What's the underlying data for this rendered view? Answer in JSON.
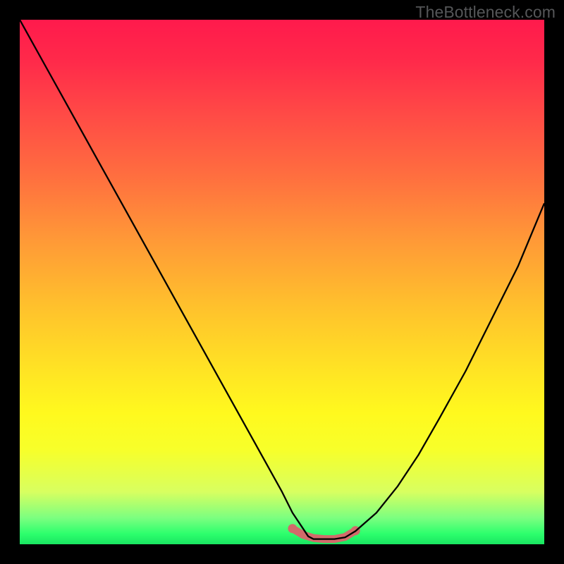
{
  "watermark": "TheBottleneck.com",
  "chart_data": {
    "type": "line",
    "title": "",
    "xlabel": "",
    "ylabel": "",
    "xlim": [
      0,
      100
    ],
    "ylim": [
      0,
      100
    ],
    "series": [
      {
        "name": "bottleneck-curve",
        "x": [
          0,
          5,
          10,
          15,
          20,
          25,
          30,
          35,
          40,
          45,
          50,
          52,
          54,
          55,
          56,
          58,
          60,
          62,
          64,
          68,
          72,
          76,
          80,
          85,
          90,
          95,
          100
        ],
        "values": [
          100,
          91,
          82,
          73,
          64,
          55,
          46,
          37,
          28,
          19,
          10,
          6,
          3,
          1.5,
          1,
          1,
          1,
          1.3,
          2.5,
          6,
          11,
          17,
          24,
          33,
          43,
          53,
          65
        ]
      },
      {
        "name": "bottom-marker-band",
        "x": [
          52,
          54,
          56,
          58,
          60,
          62,
          64
        ],
        "values": [
          3.0,
          1.8,
          1.2,
          1.0,
          1.0,
          1.4,
          2.6
        ]
      }
    ],
    "colors": {
      "curve": "#000000",
      "marker_band": "#d26b6b",
      "gradient_top": "#ff1a4c",
      "gradient_mid": "#ffe424",
      "gradient_bottom": "#19e561"
    }
  }
}
